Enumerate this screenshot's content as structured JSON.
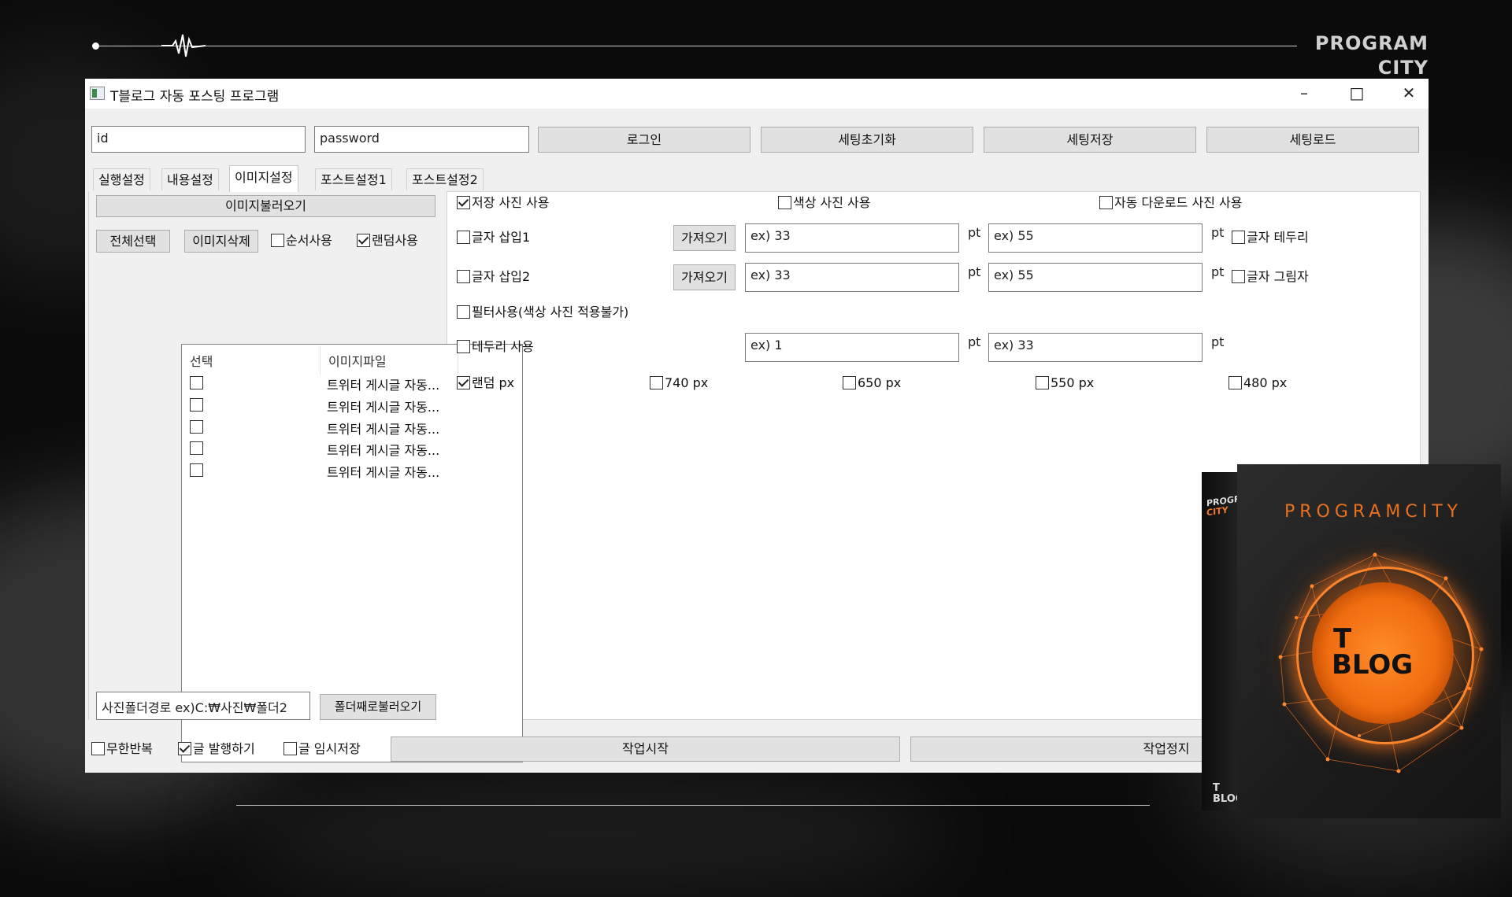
{
  "brand": {
    "line1": "PROGRAM",
    "line2": "CITY"
  },
  "window": {
    "title": "T블로그 자동 포스팅 프로그램"
  },
  "login": {
    "id_value": "id",
    "password_value": "password",
    "login_button": "로그인",
    "reset_button": "세팅초기화",
    "save_button": "세팅저장",
    "load_button": "세팅로드"
  },
  "tabs": [
    "실행설정",
    "내용설정",
    "이미지설정",
    "포스트설정1",
    "포스트설정2"
  ],
  "left": {
    "load_images_button": "이미지불러오기",
    "select_all_button": "전체선택",
    "delete_images_button": "이미지삭제",
    "sequential_label": "순서사용",
    "random_label": "랜덤사용",
    "col_select": "선택",
    "col_file": "이미지파일",
    "rows": [
      "트위터 게시글 자동...",
      "트위터 게시글 자동...",
      "트위터 게시글 자동...",
      "트위터 게시글 자동...",
      "트위터 게시글 자동..."
    ],
    "folder_path_value": "사진폴더경로 ex)C:₩사진₩폴더2",
    "load_folder_button": "폴더째로불러오기"
  },
  "right": {
    "use_saved_photo": "저장 사진 사용",
    "use_color_photo": "색상 사진 사용",
    "use_auto_download_photo": "자동 다운로드 사진 사용",
    "text_insert1": "글자 삽입1",
    "text_insert2": "글자 삽입2",
    "fetch_button": "가져오기",
    "size1_value": "ex) 33",
    "size2_value": "ex) 55",
    "unit_pt": "pt",
    "text_border": "글자 테두리",
    "text_shadow": "글자 그림자",
    "use_filter": "필터사용(색상 사진 적용불가)",
    "use_border": "테두리 사용",
    "border1_value": "ex) 1",
    "border2_value": "ex) 33",
    "random_px": "랜덤 px",
    "px740": "740 px",
    "px650": "650 px",
    "px550": "550 px",
    "px480": "480 px"
  },
  "bottom": {
    "infinite_repeat": "무한반복",
    "publish": "글 발행하기",
    "temp_save": "글 임시저장",
    "start_button": "작업시작",
    "stop_button": "작업정지"
  },
  "product_box": {
    "side_brand1": "PROGRAM",
    "side_brand2": "CITY",
    "title": "PROGRAMCITY",
    "logo_t": "T",
    "logo_blog": "BLOG",
    "side_t": "T",
    "side_blog": "BLOG"
  },
  "colors": {
    "accent": "#f07a2a",
    "window_bg": "#f0f0f0",
    "page_bg": "#0b0b0b"
  },
  "checkbox_state": {
    "sequential": false,
    "random": true,
    "saved_photo": true,
    "color_photo": false,
    "auto_download_photo": false,
    "text_insert1": false,
    "text_insert2": false,
    "text_border": false,
    "text_shadow": false,
    "filter": false,
    "border": false,
    "random_px": true,
    "px740": false,
    "px650": false,
    "px550": false,
    "px480": false,
    "infinite_repeat": false,
    "publish": true,
    "temp_save": false
  }
}
